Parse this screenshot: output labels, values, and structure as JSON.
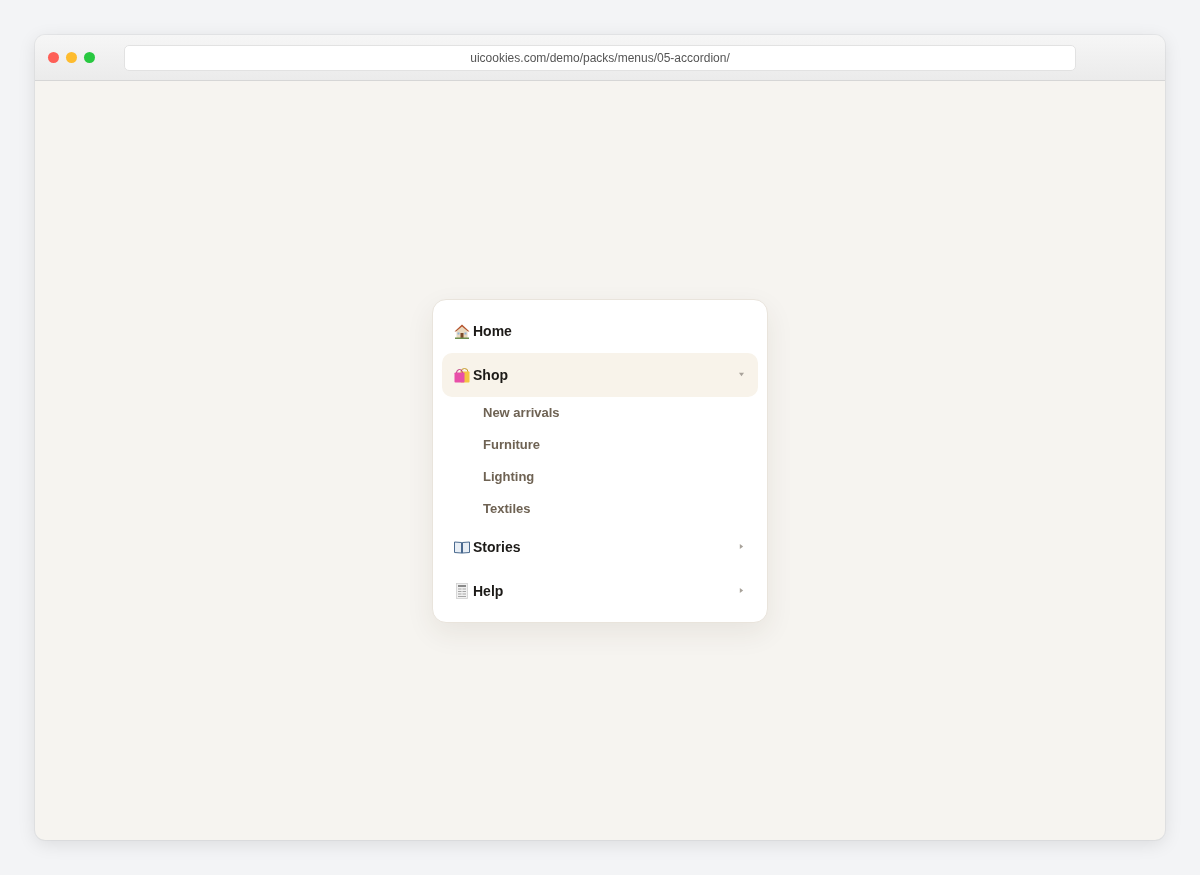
{
  "browser": {
    "url": "uicookies.com/demo/packs/menus/05-accordion/"
  },
  "menu": {
    "items": [
      {
        "kind": "link",
        "label": "Home"
      },
      {
        "kind": "group",
        "label": "Shop",
        "expanded": true,
        "children": [
          {
            "label": "New arrivals"
          },
          {
            "label": "Furniture"
          },
          {
            "label": "Lighting"
          },
          {
            "label": "Textiles"
          }
        ]
      },
      {
        "kind": "group",
        "label": "Stories",
        "expanded": false
      },
      {
        "kind": "group",
        "label": "Help",
        "expanded": false
      }
    ]
  }
}
